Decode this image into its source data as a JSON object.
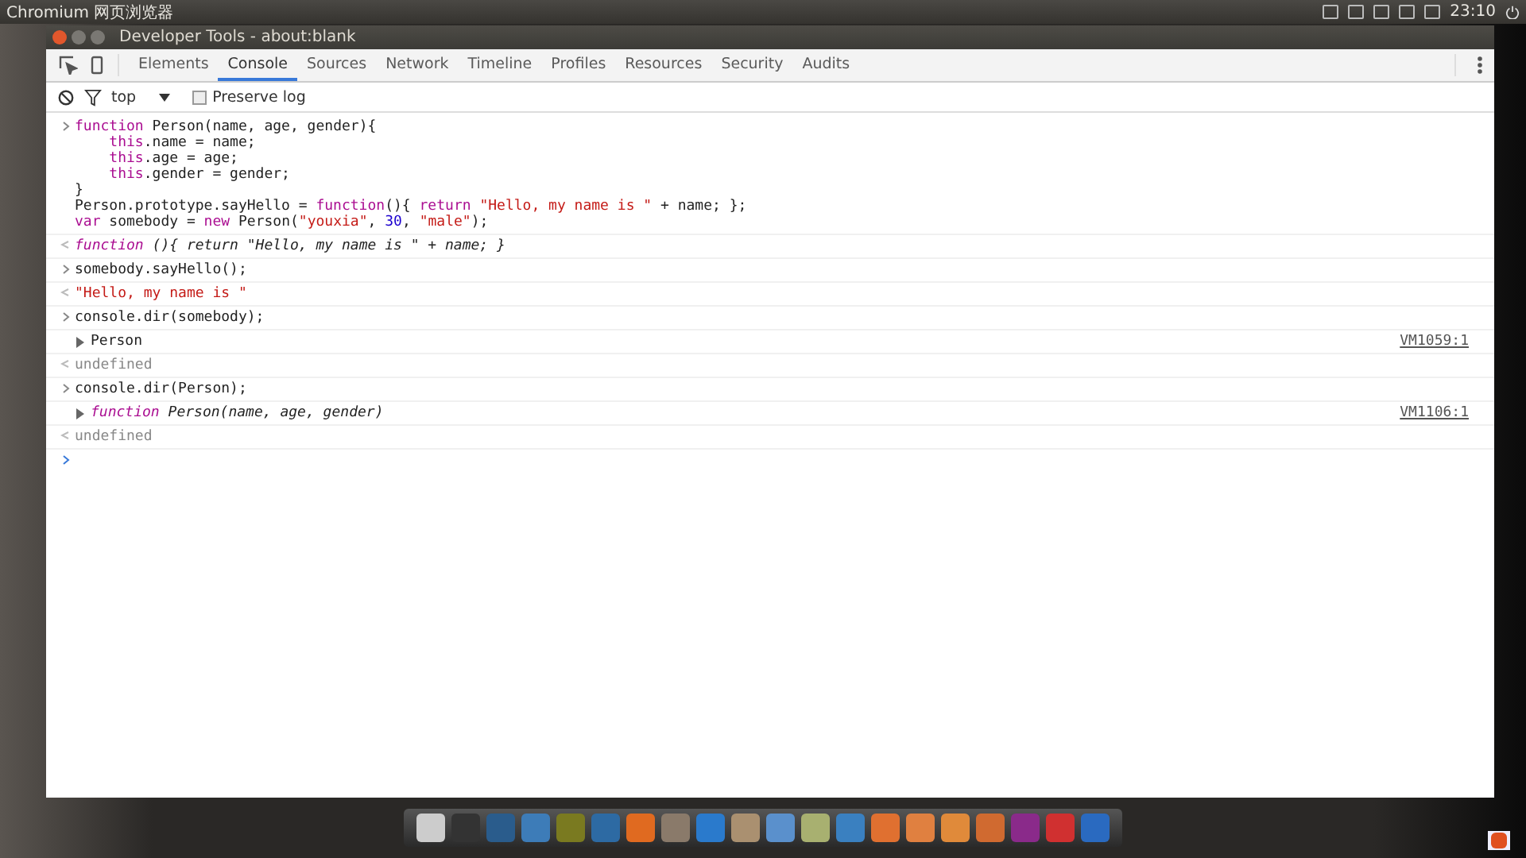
{
  "top_panel": {
    "app_name": "Chromium 网页浏览器",
    "clock": "23:10"
  },
  "window": {
    "title": "Developer Tools - about:blank"
  },
  "tabs": [
    {
      "label": "Elements",
      "selected": false
    },
    {
      "label": "Console",
      "selected": true
    },
    {
      "label": "Sources",
      "selected": false
    },
    {
      "label": "Network",
      "selected": false
    },
    {
      "label": "Timeline",
      "selected": false
    },
    {
      "label": "Profiles",
      "selected": false
    },
    {
      "label": "Resources",
      "selected": false
    },
    {
      "label": "Security",
      "selected": false
    },
    {
      "label": "Audits",
      "selected": false
    }
  ],
  "console_toolbar": {
    "context": "top",
    "preserve_log": {
      "label": "Preserve log",
      "checked": false
    }
  },
  "entries": [
    {
      "kind": "input",
      "lines": [
        {
          "indented": false,
          "segs": [
            {
              "kind": "keyword",
              "text": "function"
            },
            {
              "kind": "plain",
              "text": " Person(name, age, gender){"
            }
          ]
        },
        {
          "indented": true,
          "segs": [
            {
              "kind": "keyword",
              "text": "this"
            },
            {
              "kind": "plain",
              "text": ".name = name;"
            }
          ]
        },
        {
          "indented": true,
          "segs": [
            {
              "kind": "keyword",
              "text": "this"
            },
            {
              "kind": "plain",
              "text": ".age = age;"
            }
          ]
        },
        {
          "indented": true,
          "segs": [
            {
              "kind": "keyword",
              "text": "this"
            },
            {
              "kind": "plain",
              "text": ".gender = gender;"
            }
          ]
        },
        {
          "indented": false,
          "segs": [
            {
              "kind": "plain",
              "text": "}"
            }
          ]
        },
        {
          "indented": false,
          "segs": [
            {
              "kind": "plain",
              "text": "Person.prototype.sayHello = "
            },
            {
              "kind": "keyword",
              "text": "function"
            },
            {
              "kind": "plain",
              "text": "(){ "
            },
            {
              "kind": "keyword",
              "text": "return"
            },
            {
              "kind": "string",
              "text": " \"Hello, my name is \""
            },
            {
              "kind": "plain",
              "text": " + name; };"
            }
          ]
        },
        {
          "indented": false,
          "segs": [
            {
              "kind": "keyword",
              "text": "var"
            },
            {
              "kind": "plain",
              "text": " somebody = "
            },
            {
              "kind": "keyword",
              "text": "new"
            },
            {
              "kind": "plain",
              "text": " Person("
            },
            {
              "kind": "string",
              "text": "\"youxia\""
            },
            {
              "kind": "plain",
              "text": ", "
            },
            {
              "kind": "number",
              "text": "30"
            },
            {
              "kind": "plain",
              "text": ", "
            },
            {
              "kind": "string",
              "text": "\"male\""
            },
            {
              "kind": "plain",
              "text": ");"
            }
          ]
        }
      ]
    },
    {
      "kind": "result",
      "lines": [
        {
          "indented": false,
          "segs": [
            {
              "kind": "italic-keyword",
              "text": "function"
            },
            {
              "kind": "italic",
              "text": " (){ return \"Hello, my name is \" + name; }"
            }
          ]
        }
      ]
    },
    {
      "kind": "input",
      "lines": [
        {
          "indented": false,
          "segs": [
            {
              "kind": "plain",
              "text": "somebody.sayHello();"
            }
          ]
        }
      ]
    },
    {
      "kind": "result",
      "lines": [
        {
          "indented": false,
          "segs": [
            {
              "kind": "string",
              "text": "\"Hello, my name is \""
            }
          ]
        }
      ]
    },
    {
      "kind": "input",
      "lines": [
        {
          "indented": false,
          "segs": [
            {
              "kind": "plain",
              "text": "console.dir(somebody);"
            }
          ]
        }
      ]
    },
    {
      "kind": "log",
      "expanded": false,
      "source": "VM1059:1",
      "lines": [
        {
          "indented": false,
          "segs": [
            {
              "kind": "plain",
              "text": "Person"
            }
          ]
        }
      ]
    },
    {
      "kind": "result",
      "lines": [
        {
          "indented": false,
          "segs": [
            {
              "kind": "undefined",
              "text": "undefined"
            }
          ]
        }
      ]
    },
    {
      "kind": "input",
      "lines": [
        {
          "indented": false,
          "segs": [
            {
              "kind": "plain",
              "text": "console.dir(Person);"
            }
          ]
        }
      ]
    },
    {
      "kind": "log",
      "expanded": false,
      "source": "VM1106:1",
      "lines": [
        {
          "indented": false,
          "segs": [
            {
              "kind": "italic-keyword",
              "text": "function"
            },
            {
              "kind": "italic",
              "text": " Person(name, age, gender)"
            }
          ]
        }
      ]
    },
    {
      "kind": "result",
      "lines": [
        {
          "indented": false,
          "segs": [
            {
              "kind": "undefined",
              "text": "undefined"
            }
          ]
        }
      ]
    }
  ]
}
